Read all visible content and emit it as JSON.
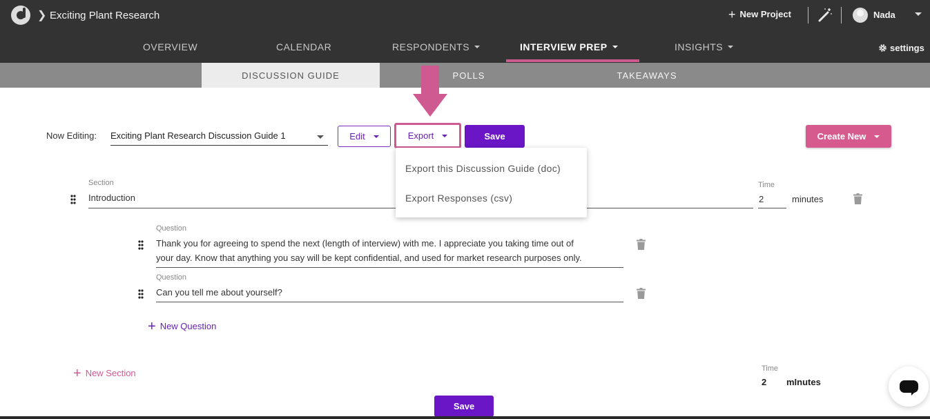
{
  "header": {
    "project_title": "Exciting Plant Research",
    "new_project_label": "New Project",
    "user_name": "Nada",
    "settings_label": "settings"
  },
  "nav": {
    "items": [
      {
        "label": "OVERVIEW"
      },
      {
        "label": "CALENDAR"
      },
      {
        "label": "RESPONDENTS"
      },
      {
        "label": "INTERVIEW PREP"
      },
      {
        "label": "INSIGHTS"
      }
    ],
    "active": "INTERVIEW PREP"
  },
  "subnav": {
    "items": [
      {
        "label": "DISCUSSION GUIDE"
      },
      {
        "label": "POLLS"
      },
      {
        "label": "TAKEAWAYS"
      }
    ],
    "active": "DISCUSSION GUIDE"
  },
  "editor": {
    "now_editing_label": "Now Editing:",
    "selected_guide": "Exciting Plant Research Discussion Guide 1",
    "edit_label": "Edit",
    "export_label": "Export",
    "save_label": "Save",
    "create_new_label": "Create New"
  },
  "export_menu": {
    "items": [
      {
        "label": "Export this Discussion Guide (doc)"
      },
      {
        "label": "Export Responses (csv)"
      }
    ]
  },
  "section": {
    "label": "Section",
    "value": "Introduction",
    "time_label": "Time",
    "time_value": "2",
    "time_unit": "minutes",
    "questions": [
      {
        "label": "Question",
        "line1": "Thank you for agreeing to spend the next (length of interview) with me. I appreciate you taking time out of",
        "line2": "your day. Know that anything you say will be kept confidential, and used for market research purposes only."
      },
      {
        "label": "Question",
        "line1": "Can you tell me about yourself?"
      }
    ],
    "new_question_label": "New Question"
  },
  "footer": {
    "new_section_label": "New Section",
    "total_time_label": "Time",
    "total_time_value": "2",
    "total_time_unit": "mInutes",
    "save_label": "Save"
  },
  "colors": {
    "accent_purple": "#6a16c7",
    "accent_pink": "#cf5a92",
    "topbar": "#333333",
    "subbar": "#8a8a8a"
  }
}
